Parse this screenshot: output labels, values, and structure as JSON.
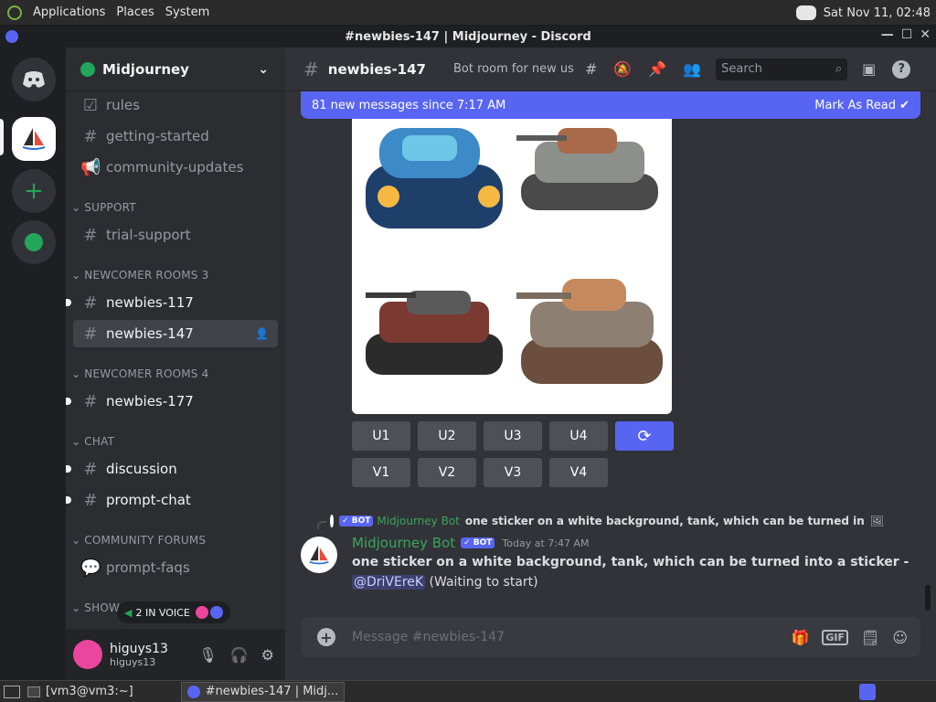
{
  "os": {
    "menu": [
      "Applications",
      "Places",
      "System"
    ],
    "clock": "Sat Nov 11, 02:48"
  },
  "window": {
    "title": "#newbies-147 | Midjourney - Discord"
  },
  "server": {
    "name": "Midjourney"
  },
  "channels": {
    "rules": "rules",
    "getting_started": "getting-started",
    "community_updates": "community-updates",
    "cat_support": "SUPPORT",
    "trial_support": "trial-support",
    "cat_newcomer3": "NEWCOMER ROOMS 3",
    "newbies117": "newbies-117",
    "newbies147": "newbies-147",
    "cat_newcomer4": "NEWCOMER ROOMS 4",
    "newbies177": "newbies-177",
    "cat_chat": "CHAT",
    "discussion": "discussion",
    "prompt_chat": "prompt-chat",
    "cat_forums": "COMMUNITY FORUMS",
    "prompt_faqs": "prompt-faqs",
    "cat_show": "SHOWC"
  },
  "voice": {
    "label": "2 IN VOICE"
  },
  "user": {
    "name": "higuys13",
    "tag": "higuys13"
  },
  "topbar": {
    "channel": "newbies-147",
    "topic": "Bot room for new us...",
    "search_placeholder": "Search"
  },
  "banner": {
    "text": "81 new messages since 7:17 AM",
    "action": "Mark As Read"
  },
  "buttons": {
    "row1": [
      "U1",
      "U2",
      "U3",
      "U4"
    ],
    "row2": [
      "V1",
      "V2",
      "V3",
      "V4"
    ]
  },
  "reply": {
    "badge": "✓ BOT",
    "author": "Midjourney Bot",
    "text": "one sticker on a white background, tank, which can be turned in"
  },
  "message": {
    "author": "Midjourney Bot",
    "badge": "✓ BOT",
    "time": "Today at 7:47 AM",
    "prompt": "one sticker on a white background, tank, which can be turned into a sticker -",
    "mention": "@DriVEreK",
    "status": "(Waiting to start)"
  },
  "composer": {
    "placeholder": "Message #newbies-147",
    "gif": "GIF"
  },
  "taskbar": {
    "terminal": "[vm3@vm3:~]",
    "discord": "#newbies-147 | Midj..."
  },
  "colors": {
    "blurple": "#5865f2",
    "green": "#23a55a",
    "link": "#c9cdfb"
  }
}
